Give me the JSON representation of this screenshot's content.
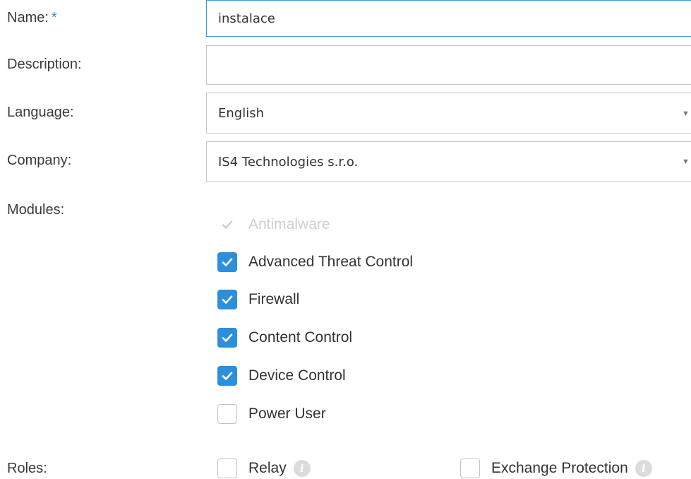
{
  "form": {
    "name": {
      "label": "Name:",
      "required_mark": "*",
      "value": "instalace"
    },
    "description": {
      "label": "Description:",
      "value": ""
    },
    "language": {
      "label": "Language:",
      "selected": "English"
    },
    "company": {
      "label": "Company:",
      "selected": "IS4 Technologies s.r.o."
    },
    "modules": {
      "label": "Modules:",
      "items": [
        {
          "label": "Antimalware",
          "checked": true,
          "disabled": true
        },
        {
          "label": "Advanced Threat Control",
          "checked": true,
          "disabled": false
        },
        {
          "label": "Firewall",
          "checked": true,
          "disabled": false
        },
        {
          "label": "Content Control",
          "checked": true,
          "disabled": false
        },
        {
          "label": "Device Control",
          "checked": true,
          "disabled": false
        },
        {
          "label": "Power User",
          "checked": false,
          "disabled": false
        }
      ]
    },
    "roles": {
      "label": "Roles:",
      "items": [
        {
          "label": "Relay",
          "checked": false,
          "icon": "info-icon"
        },
        {
          "label": "Exchange Protection",
          "checked": false,
          "icon": "info-icon"
        }
      ]
    }
  },
  "colors": {
    "accent": "#2b8fdb",
    "focus_border": "#3a9bdc",
    "border": "#c7c7c7",
    "required": "#2a91d8",
    "disabled_text": "#cfcfcf"
  }
}
